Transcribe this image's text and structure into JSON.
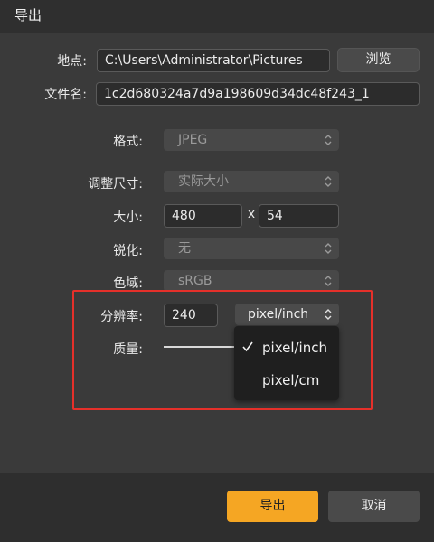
{
  "dialog": {
    "title": "导出"
  },
  "location": {
    "label": "地点:",
    "value": "C:\\Users\\Administrator\\Pictures",
    "browse_label": "浏览"
  },
  "filename": {
    "label": "文件名:",
    "value": "1c2d680324a7d9a198609d34dc48f243_1"
  },
  "format": {
    "label": "格式:",
    "value": "JPEG"
  },
  "resize": {
    "label": "调整尺寸:",
    "value": "实际大小"
  },
  "size": {
    "label": "大小:",
    "width": "480",
    "separator": "x",
    "height": "54"
  },
  "sharpen": {
    "label": "锐化:",
    "value": "无"
  },
  "color_space": {
    "label": "色域:",
    "value": "sRGB"
  },
  "resolution": {
    "label": "分辨率:",
    "value": "240",
    "unit": "pixel/inch",
    "unit_options": [
      "pixel/inch",
      "pixel/cm"
    ],
    "selected_index": 0
  },
  "quality": {
    "label": "质量:"
  },
  "footer": {
    "ok_label": "导出",
    "cancel_label": "取消"
  },
  "colors": {
    "accent": "#f5a623",
    "highlight": "#e5302a",
    "background": "#3a3a3a"
  },
  "icons": [
    "chevron-updown-icon",
    "checkmark-icon"
  ]
}
